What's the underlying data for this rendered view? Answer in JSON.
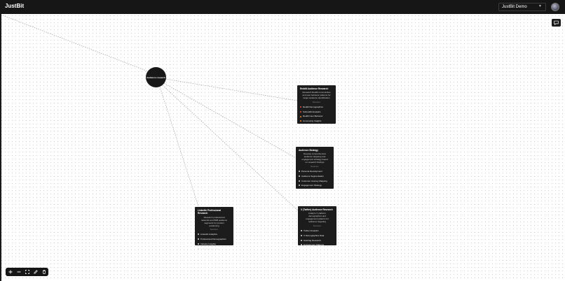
{
  "app": {
    "brand": "JustBit"
  },
  "workspace": {
    "selected": "JustBit Demo"
  },
  "root_node": {
    "label": "Audience research"
  },
  "cards": [
    {
      "title": "Reddit Audience Research",
      "description": "Research Reddit communities and user behavior patterns for target audience identification",
      "sources_label": "Sources:",
      "items": [
        "Reddit Demographics",
        "Subreddit Analytics",
        "Reddit User Behavior",
        "Community Insights"
      ]
    },
    {
      "title": "Audience Strategy",
      "description": "Develop comprehensive audience targeting and engagement strategy based on research findings",
      "sources_label": "Sources:",
      "items": [
        "Persona Development",
        "Audience Segmentation",
        "Customer Journey Mapping",
        "Engagement Strategy"
      ]
    },
    {
      "title": "LinkedIn Professional Research",
      "description": "Research professional networks and B2B audience segments for product positioning",
      "sources_label": "Sources:",
      "items": [
        "LinkedIn Analytics",
        "Professional Demographics",
        "Industry Insights",
        "B2B Marketing Tools"
      ]
    },
    {
      "title": "X (Twitter) Audience Research",
      "description": "Analyze X platform demographics and engagement patterns for audience targeting",
      "sources_label": "Sources:",
      "items": [
        "Twitter Analytics",
        "X Demographics Data",
        "Hashtag Research",
        "Engagement Patterns"
      ]
    }
  ],
  "colors": {
    "topbar": "#161616",
    "card": "#1c1c1c",
    "reddit_dot": "#e25141",
    "orange_dot": "#f08c2e"
  },
  "icons": {
    "chat": "chat-bubble-icon",
    "toolbar": [
      "plus-icon",
      "minus-icon",
      "fit-view-icon",
      "pen-icon",
      "trash-icon"
    ]
  }
}
